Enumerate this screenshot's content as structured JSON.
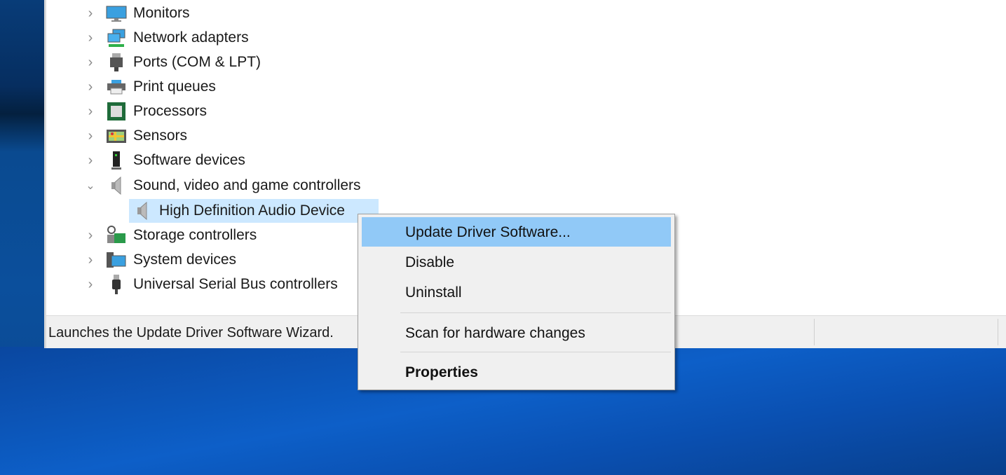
{
  "tree": {
    "items": [
      {
        "label": "Monitors",
        "icon": "monitor-icon",
        "expanded": false
      },
      {
        "label": "Network adapters",
        "icon": "network-adapter-icon",
        "expanded": false
      },
      {
        "label": "Ports (COM & LPT)",
        "icon": "port-icon",
        "expanded": false
      },
      {
        "label": "Print queues",
        "icon": "printer-icon",
        "expanded": false
      },
      {
        "label": "Processors",
        "icon": "processor-icon",
        "expanded": false
      },
      {
        "label": "Sensors",
        "icon": "sensor-icon",
        "expanded": false
      },
      {
        "label": "Software devices",
        "icon": "software-device-icon",
        "expanded": false
      },
      {
        "label": "Sound, video and game controllers",
        "icon": "speaker-icon",
        "expanded": true
      },
      {
        "label": "Storage controllers",
        "icon": "storage-controller-icon",
        "expanded": false
      },
      {
        "label": "System devices",
        "icon": "system-device-icon",
        "expanded": false
      },
      {
        "label": "Universal Serial Bus controllers",
        "icon": "usb-icon",
        "expanded": false
      }
    ],
    "child": {
      "label": "High Definition Audio Device",
      "icon": "speaker-icon",
      "selected": true
    }
  },
  "status_bar": {
    "text": "Launches the Update Driver Software Wizard."
  },
  "context_menu": {
    "items": [
      {
        "label": "Update Driver Software...",
        "highlighted": true
      },
      {
        "label": "Disable"
      },
      {
        "label": "Uninstall"
      },
      {
        "label": "Scan for hardware changes"
      },
      {
        "label": "Properties",
        "bold": true
      }
    ]
  },
  "colors": {
    "highlight": "#91c9f7",
    "selection": "#cce8ff",
    "desktop": "#0b4f9c"
  }
}
